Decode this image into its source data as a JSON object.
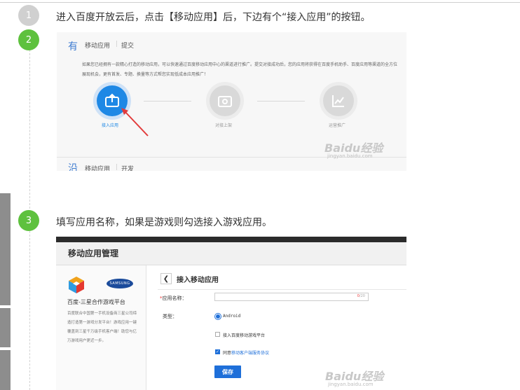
{
  "steps": [
    {
      "number": "1",
      "text": "进入百度开放云后，点击【移动应用】后，下边有个“接入应用”的按钮。"
    },
    {
      "number": "2",
      "text": ""
    },
    {
      "number": "3",
      "text": "填写应用名称，如果是游戏则勾选接入游戏应用。"
    }
  ],
  "shot1": {
    "tab_icon": "有",
    "tab1": "移动应用",
    "tab2": "提交",
    "description": "如果您已经拥有一款精心打造的移动应用，可以快速通过百度移动应用中心的渠道进行推广。提交对接成功后，您的应用将获得在百度手机助手、百度应用等渠道的全方位展现机会，更有首发、专题、换量等方式帮您实现低成本应用推广！",
    "nodes": [
      {
        "label": "接入应用",
        "icon": "upload-icon",
        "active": true
      },
      {
        "label": "对接上架",
        "icon": "box-icon",
        "active": false
      },
      {
        "label": "运营推广",
        "icon": "chart-icon",
        "active": false
      }
    ],
    "bottom_icon": "沿",
    "bottom_tab1": "移动应用",
    "bottom_tab2": "开发",
    "watermark": "Baidu经验",
    "watermark_sub": "jingyan.baidu.com"
  },
  "shot2": {
    "header_title": "移动应用管理",
    "brand_logo": "SAMSUNG",
    "brand_title": "百度-三星合作游戏平台",
    "intro": "百度联合中国第一手机设备商三星公司缔造打造第一游戏分发平台！游戏应用一键覆盖到三星千万级手机客户端！助您与亿万游戏用户更近一步。",
    "back_symbol": "❮",
    "form_title": "接入移动应用",
    "required_mark": "*",
    "name_label": "应用名称：",
    "name_value": "",
    "counter_current": "0",
    "counter_sep": "/",
    "counter_max": "20",
    "type_label": "类型：",
    "type_value": "Android",
    "check_game_label": "接入百度移动游戏平台",
    "agree_prefix": "同意",
    "agree_link": "移动客户端服务协议",
    "save_label": "保存",
    "watermark": "Baidu经验",
    "watermark_sub": "jingyan.baidu.com"
  },
  "colors": {
    "step_active": "#5ec13e",
    "step_inactive": "#d0d0d0",
    "accent_blue": "#1e6fd9"
  }
}
